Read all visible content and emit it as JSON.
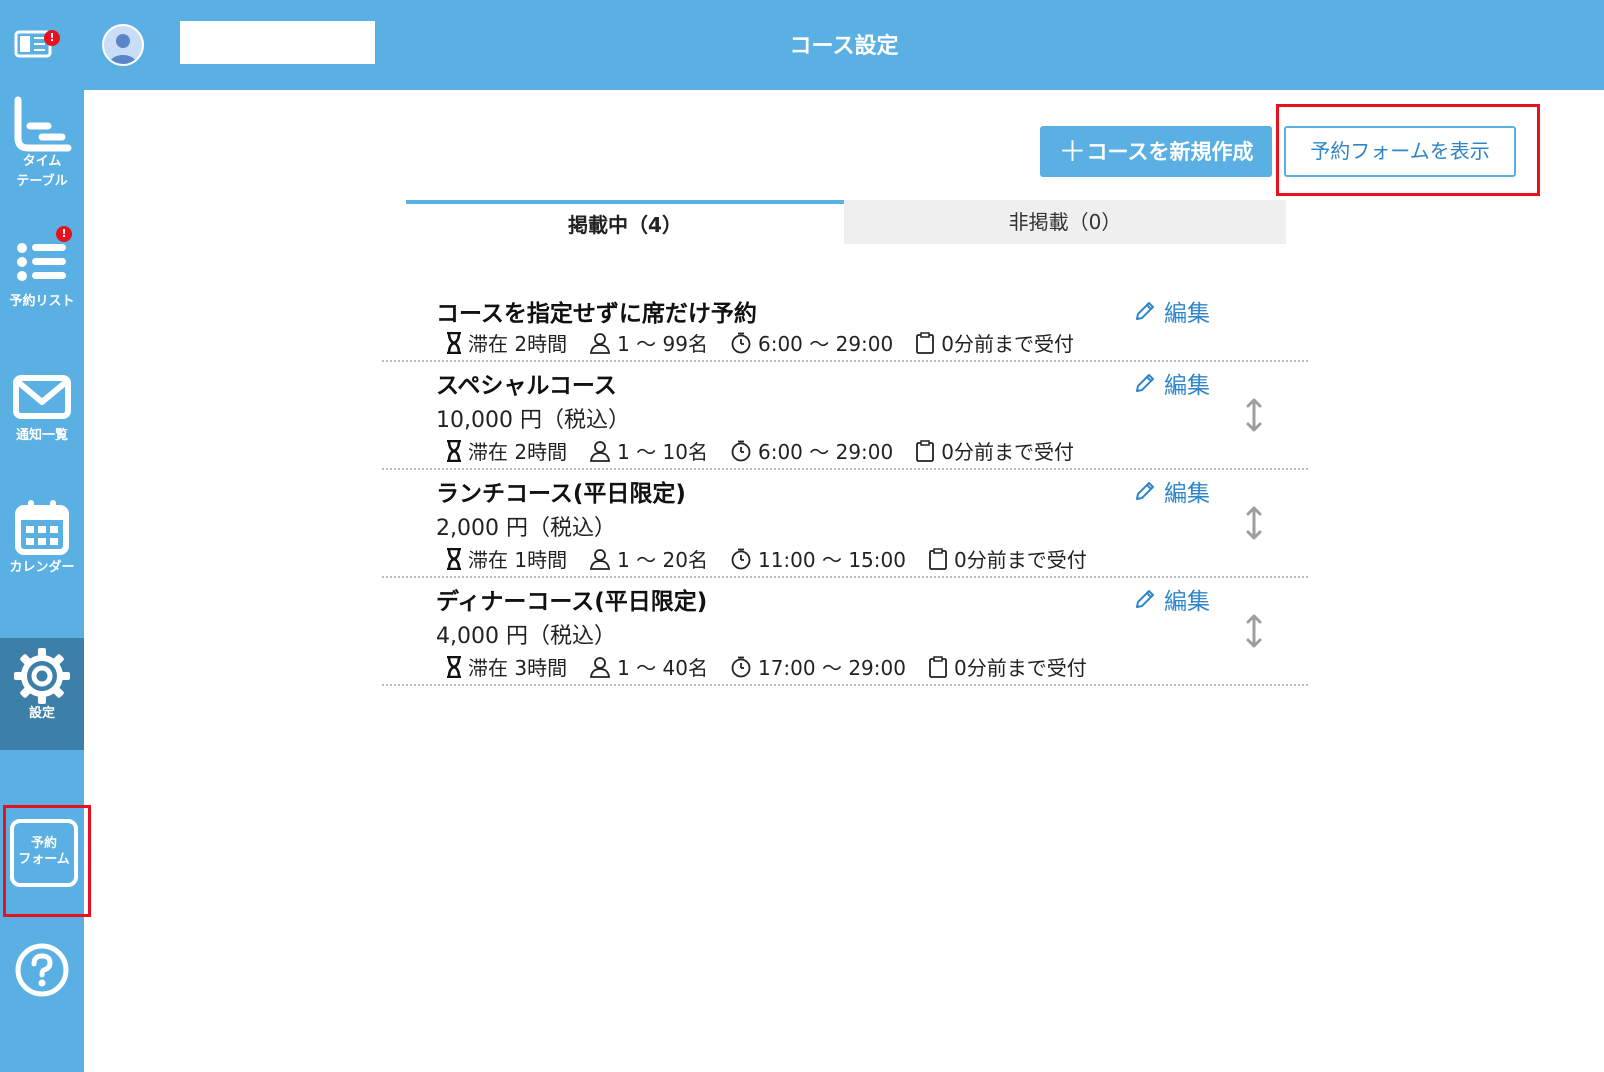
{
  "header": {
    "title": "コース設定",
    "menu_badge": "!"
  },
  "sidebar": {
    "items": [
      {
        "label_line1": "タイム",
        "label_line2": "テーブル",
        "icon": "timetable-icon"
      },
      {
        "label": "予約リスト",
        "icon": "list-icon",
        "badge": "!"
      },
      {
        "label": "通知一覧",
        "icon": "mail-icon"
      },
      {
        "label": "カレンダー",
        "icon": "calendar-icon"
      },
      {
        "label": "設定",
        "icon": "gear-icon"
      }
    ],
    "form_button": {
      "line1": "予約",
      "line2": "フォーム"
    },
    "help_icon": "help-icon"
  },
  "actions": {
    "new_course_plus": "＋",
    "new_course": "コースを新規作成",
    "show_form": "予約フォームを表示"
  },
  "tabs": [
    {
      "label": "掲載中（4）",
      "active": true
    },
    {
      "label": "非掲載（0）",
      "active": false
    }
  ],
  "courses": [
    {
      "name": "コースを指定せずに席だけ予約",
      "price": "",
      "stay": "滞在 2時間",
      "people": "1 〜 99名",
      "time": "6:00 〜 29:00",
      "deadline": "0分前まで受付",
      "edit": "編集"
    },
    {
      "name": "スペシャルコース",
      "price": "10,000 円（税込）",
      "stay": "滞在 2時間",
      "people": "1 〜 10名",
      "time": "6:00 〜 29:00",
      "deadline": "0分前まで受付",
      "edit": "編集"
    },
    {
      "name": "ランチコース(平日限定)",
      "price": "2,000 円（税込）",
      "stay": "滞在 1時間",
      "people": "1 〜 20名",
      "time": "11:00 〜 15:00",
      "deadline": "0分前まで受付",
      "edit": "編集"
    },
    {
      "name": "ディナーコース(平日限定)",
      "price": "4,000 円（税込）",
      "stay": "滞在 3時間",
      "people": "1 〜 40名",
      "time": "17:00 〜 29:00",
      "deadline": "0分前まで受付",
      "edit": "編集"
    }
  ],
  "colors": {
    "primary": "#5aafe3",
    "sidebar_active": "#3c7fa9",
    "link": "#2e86c9",
    "highlight": "#e8121e"
  }
}
